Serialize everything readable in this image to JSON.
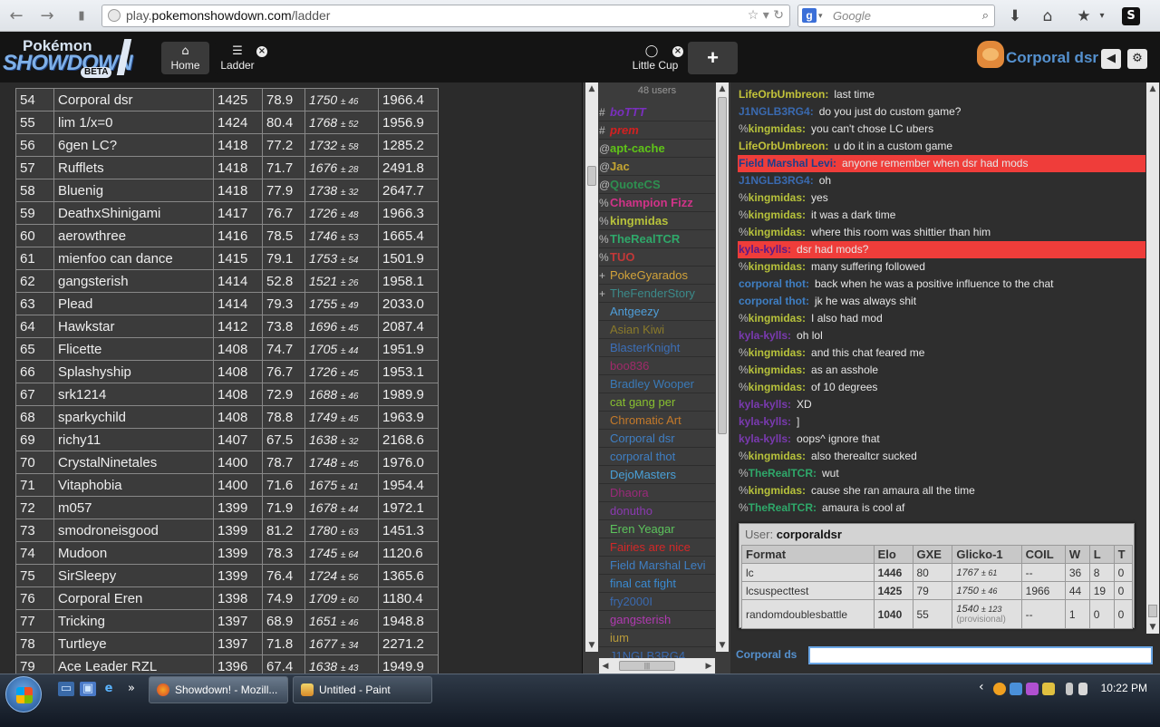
{
  "browser": {
    "url_prefix": "play.",
    "url_domain": "pokemonshowdown.com",
    "url_path": "/ladder",
    "search_placeholder": "Google",
    "search_engine_letter": "g"
  },
  "header": {
    "logo_line1": "Pokémon",
    "logo_line2": "SHOWDOWN",
    "logo_badge": "BETA",
    "tabs": [
      {
        "label": "Home",
        "icon": "home-icon"
      },
      {
        "label": "Ladder",
        "icon": "list-icon"
      },
      {
        "label": "Little Cup",
        "icon": "chat-bubble-icon"
      }
    ],
    "plus_label": "+",
    "username": "Corporal dsr"
  },
  "ladder": {
    "rows": [
      {
        "rank": "54",
        "name": "Corporal dsr",
        "elo": "1425",
        "gxe": "78.9",
        "glicko": "1750",
        "dev": "± 46",
        "coil": "1966.4"
      },
      {
        "rank": "55",
        "name": "lim 1/x=0",
        "elo": "1424",
        "gxe": "80.4",
        "glicko": "1768",
        "dev": "± 52",
        "coil": "1956.9"
      },
      {
        "rank": "56",
        "name": "6gen LC?",
        "elo": "1418",
        "gxe": "77.2",
        "glicko": "1732",
        "dev": "± 58",
        "coil": "1285.2"
      },
      {
        "rank": "57",
        "name": "Rufflets",
        "elo": "1418",
        "gxe": "71.7",
        "glicko": "1676",
        "dev": "± 28",
        "coil": "2491.8"
      },
      {
        "rank": "58",
        "name": "Bluenig",
        "elo": "1418",
        "gxe": "77.9",
        "glicko": "1738",
        "dev": "± 32",
        "coil": "2647.7"
      },
      {
        "rank": "59",
        "name": "DeathxShinigami",
        "elo": "1417",
        "gxe": "76.7",
        "glicko": "1726",
        "dev": "± 48",
        "coil": "1966.3"
      },
      {
        "rank": "60",
        "name": "aerowthree",
        "elo": "1416",
        "gxe": "78.5",
        "glicko": "1746",
        "dev": "± 53",
        "coil": "1665.4"
      },
      {
        "rank": "61",
        "name": "mienfoo can dance",
        "elo": "1415",
        "gxe": "79.1",
        "glicko": "1753",
        "dev": "± 54",
        "coil": "1501.9"
      },
      {
        "rank": "62",
        "name": "gangsterish",
        "elo": "1414",
        "gxe": "52.8",
        "glicko": "1521",
        "dev": "± 26",
        "coil": "1958.1"
      },
      {
        "rank": "63",
        "name": "Plead",
        "elo": "1414",
        "gxe": "79.3",
        "glicko": "1755",
        "dev": "± 49",
        "coil": "2033.0"
      },
      {
        "rank": "64",
        "name": "Hawkstar",
        "elo": "1412",
        "gxe": "73.8",
        "glicko": "1696",
        "dev": "± 45",
        "coil": "2087.4"
      },
      {
        "rank": "65",
        "name": "Flicette",
        "elo": "1408",
        "gxe": "74.7",
        "glicko": "1705",
        "dev": "± 44",
        "coil": "1951.9"
      },
      {
        "rank": "66",
        "name": "Splashyship",
        "elo": "1408",
        "gxe": "76.7",
        "glicko": "1726",
        "dev": "± 45",
        "coil": "1953.1"
      },
      {
        "rank": "67",
        "name": "srk1214",
        "elo": "1408",
        "gxe": "72.9",
        "glicko": "1688",
        "dev": "± 46",
        "coil": "1989.9"
      },
      {
        "rank": "68",
        "name": "sparkychild",
        "elo": "1408",
        "gxe": "78.8",
        "glicko": "1749",
        "dev": "± 45",
        "coil": "1963.9"
      },
      {
        "rank": "69",
        "name": "richy11",
        "elo": "1407",
        "gxe": "67.5",
        "glicko": "1638",
        "dev": "± 32",
        "coil": "2168.6"
      },
      {
        "rank": "70",
        "name": "CrystalNinetales",
        "elo": "1400",
        "gxe": "78.7",
        "glicko": "1748",
        "dev": "± 45",
        "coil": "1976.0"
      },
      {
        "rank": "71",
        "name": "Vitaphobia",
        "elo": "1400",
        "gxe": "71.6",
        "glicko": "1675",
        "dev": "± 41",
        "coil": "1954.4"
      },
      {
        "rank": "72",
        "name": "m057",
        "elo": "1399",
        "gxe": "71.9",
        "glicko": "1678",
        "dev": "± 44",
        "coil": "1972.1"
      },
      {
        "rank": "73",
        "name": "smodroneisgood",
        "elo": "1399",
        "gxe": "81.2",
        "glicko": "1780",
        "dev": "± 63",
        "coil": "1451.3"
      },
      {
        "rank": "74",
        "name": "Mudoon",
        "elo": "1399",
        "gxe": "78.3",
        "glicko": "1745",
        "dev": "± 64",
        "coil": "1120.6"
      },
      {
        "rank": "75",
        "name": "SirSleepy",
        "elo": "1399",
        "gxe": "76.4",
        "glicko": "1724",
        "dev": "± 56",
        "coil": "1365.6"
      },
      {
        "rank": "76",
        "name": "Corporal Eren",
        "elo": "1398",
        "gxe": "74.9",
        "glicko": "1709",
        "dev": "± 60",
        "coil": "1180.4"
      },
      {
        "rank": "77",
        "name": "Tricking",
        "elo": "1397",
        "gxe": "68.9",
        "glicko": "1651",
        "dev": "± 46",
        "coil": "1948.8"
      },
      {
        "rank": "78",
        "name": "Turtleye",
        "elo": "1397",
        "gxe": "71.8",
        "glicko": "1677",
        "dev": "± 34",
        "coil": "2271.2"
      },
      {
        "rank": "79",
        "name": "Ace Leader RZL",
        "elo": "1396",
        "gxe": "67.4",
        "glicko": "1638",
        "dev": "± 43",
        "coil": "1949.9"
      }
    ]
  },
  "userlist": {
    "count_label": "48 users",
    "users": [
      {
        "group": "#",
        "name": "boTTT",
        "color": "#7a2fbf",
        "style": "italic"
      },
      {
        "group": "#",
        "name": "prem",
        "color": "#d32020",
        "style": "italic"
      },
      {
        "group": "@",
        "name": "apt-cache",
        "color": "#5fc418",
        "style": "bold"
      },
      {
        "group": "@",
        "name": "Jac",
        "color": "#c4a532",
        "style": "bold"
      },
      {
        "group": "@",
        "name": "QuoteCS",
        "color": "#2e8f50",
        "style": "bold"
      },
      {
        "group": "%",
        "name": "Champion Fizz",
        "color": "#d03388",
        "style": "bold"
      },
      {
        "group": "%",
        "name": "kingmidas",
        "color": "#b7c23b",
        "style": "bold"
      },
      {
        "group": "%",
        "name": "TheRealTCR",
        "color": "#2fa86a",
        "style": "bold"
      },
      {
        "group": "%",
        "name": "TUO",
        "color": "#c23838",
        "style": "bold"
      },
      {
        "group": "+",
        "name": "PokeGyarados",
        "color": "#d2a33a",
        "style": "normal"
      },
      {
        "group": "+",
        "name": "TheFenderStory",
        "color": "#3b8a8a",
        "style": "normal"
      },
      {
        "group": "",
        "name": "Antgeezy",
        "color": "#4f9ed9",
        "style": "normal"
      },
      {
        "group": "",
        "name": "Asian Kiwi",
        "color": "#8a7a2a",
        "style": "normal"
      },
      {
        "group": "",
        "name": "BlasterKnight",
        "color": "#3c6fb8",
        "style": "normal"
      },
      {
        "group": "",
        "name": "boo836",
        "color": "#a02a6a",
        "style": "normal"
      },
      {
        "group": "",
        "name": "Bradley Wooper",
        "color": "#3a7ab8",
        "style": "normal"
      },
      {
        "group": "",
        "name": "cat gang per",
        "color": "#88c030",
        "style": "normal"
      },
      {
        "group": "",
        "name": "Chromatic Art",
        "color": "#c57a2a",
        "style": "normal"
      },
      {
        "group": "",
        "name": "Corporal dsr",
        "color": "#3f7fc4",
        "style": "normal"
      },
      {
        "group": "",
        "name": "corporal thot",
        "color": "#3f7fc4",
        "style": "normal"
      },
      {
        "group": "",
        "name": "DejoMasters",
        "color": "#4aa0d8",
        "style": "normal"
      },
      {
        "group": "",
        "name": "Dhaora",
        "color": "#9a2a7a",
        "style": "normal"
      },
      {
        "group": "",
        "name": "donutho",
        "color": "#8a3ab0",
        "style": "normal"
      },
      {
        "group": "",
        "name": "Eren Yeagar",
        "color": "#5cc35c",
        "style": "normal"
      },
      {
        "group": "",
        "name": "Fairies are nice",
        "color": "#d32828",
        "style": "normal"
      },
      {
        "group": "",
        "name": "Field Marshal Levi",
        "color": "#3f7fc4",
        "style": "normal"
      },
      {
        "group": "",
        "name": "final cat fight",
        "color": "#3a8ad0",
        "style": "normal"
      },
      {
        "group": "",
        "name": "fry2000I",
        "color": "#3a6ab0",
        "style": "normal"
      },
      {
        "group": "",
        "name": "gangsterish",
        "color": "#b03ab0",
        "style": "normal"
      },
      {
        "group": "",
        "name": "ium",
        "color": "#b89a3a",
        "style": "normal"
      },
      {
        "group": "",
        "name": "J1NGLB3RG4",
        "color": "#3a6ab0",
        "style": "normal"
      }
    ]
  },
  "chat": {
    "messages": [
      {
        "sym": "",
        "user": "LifeOrbUmbreon:",
        "color": "#c3c33a",
        "text": "last time",
        "hl": false
      },
      {
        "sym": "",
        "user": "J1NGLB3RG4:",
        "color": "#3a6ab0",
        "text": "do you just do custom game?",
        "hl": false
      },
      {
        "sym": "%",
        "user": "kingmidas:",
        "color": "#b7c23b",
        "text": "you can't chose LC ubers",
        "hl": false
      },
      {
        "sym": "",
        "user": "LifeOrbUmbreon:",
        "color": "#c3c33a",
        "text": "u do it in a custom game",
        "hl": false
      },
      {
        "sym": "",
        "user": "Field Marshal Levi:",
        "color": "#1c3e8a",
        "text": "anyone remember when dsr had mods",
        "hl": true
      },
      {
        "sym": "",
        "user": "J1NGLB3RG4:",
        "color": "#3a6ab0",
        "text": "oh",
        "hl": false
      },
      {
        "sym": "%",
        "user": "kingmidas:",
        "color": "#b7c23b",
        "text": "yes",
        "hl": false
      },
      {
        "sym": "%",
        "user": "kingmidas:",
        "color": "#b7c23b",
        "text": "it was a dark time",
        "hl": false
      },
      {
        "sym": "%",
        "user": "kingmidas:",
        "color": "#b7c23b",
        "text": "where this room was shittier than him",
        "hl": false
      },
      {
        "sym": "",
        "user": "kyla-kylls:",
        "color": "#5a1a8a",
        "text": "dsr had mods?",
        "hl": true
      },
      {
        "sym": "%",
        "user": "kingmidas:",
        "color": "#b7c23b",
        "text": "many suffering followed",
        "hl": false
      },
      {
        "sym": "",
        "user": "corporal thot:",
        "color": "#3f7fc4",
        "text": "back when he was a positive influence to the chat",
        "hl": false
      },
      {
        "sym": "",
        "user": "corporal thot:",
        "color": "#3f7fc4",
        "text": "jk he was always shit",
        "hl": false
      },
      {
        "sym": "%",
        "user": "kingmidas:",
        "color": "#b7c23b",
        "text": "I also had mod",
        "hl": false
      },
      {
        "sym": "",
        "user": "kyla-kylls:",
        "color": "#7a3ab0",
        "text": "oh lol",
        "hl": false
      },
      {
        "sym": "%",
        "user": "kingmidas:",
        "color": "#b7c23b",
        "text": "and this chat feared me",
        "hl": false
      },
      {
        "sym": "%",
        "user": "kingmidas:",
        "color": "#b7c23b",
        "text": "as an asshole",
        "hl": false
      },
      {
        "sym": "%",
        "user": "kingmidas:",
        "color": "#b7c23b",
        "text": "of 10 degrees",
        "hl": false
      },
      {
        "sym": "",
        "user": "kyla-kylls:",
        "color": "#7a3ab0",
        "text": "XD",
        "hl": false
      },
      {
        "sym": "",
        "user": "kyla-kylls:",
        "color": "#7a3ab0",
        "text": "]",
        "hl": false
      },
      {
        "sym": "",
        "user": "kyla-kylls:",
        "color": "#7a3ab0",
        "text": "oops^ ignore that",
        "hl": false
      },
      {
        "sym": "%",
        "user": "kingmidas:",
        "color": "#b7c23b",
        "text": "also therealtcr sucked",
        "hl": false
      },
      {
        "sym": "%",
        "user": "TheRealTCR:",
        "color": "#2fa86a",
        "text": "wut",
        "hl": false
      },
      {
        "sym": "%",
        "user": "kingmidas:",
        "color": "#b7c23b",
        "text": "cause she ran amaura all the time",
        "hl": false
      },
      {
        "sym": "%",
        "user": "TheRealTCR:",
        "color": "#2fa86a",
        "text": "amaura is cool af",
        "hl": false
      }
    ],
    "input_label": "Corporal ds",
    "input_value": ""
  },
  "popup": {
    "user_label": "User:",
    "user_name": "corporaldsr",
    "headers": [
      "Format",
      "Elo",
      "GXE",
      "Glicko-1",
      "COIL",
      "W",
      "L",
      "T"
    ],
    "rows": [
      {
        "format": "lc",
        "elo": "1446",
        "gxe": "80",
        "glicko": "1767",
        "dev": "± 61",
        "prov": "",
        "coil": "--",
        "w": "36",
        "l": "8",
        "t": "0"
      },
      {
        "format": "lcsuspecttest",
        "elo": "1425",
        "gxe": "79",
        "glicko": "1750",
        "dev": "± 46",
        "prov": "",
        "coil": "1966",
        "w": "44",
        "l": "19",
        "t": "0"
      },
      {
        "format": "randomdoublesbattle",
        "elo": "1040",
        "gxe": "55",
        "glicko": "1540",
        "dev": "± 123",
        "prov": "(provisional)",
        "coil": "--",
        "w": "1",
        "l": "0",
        "t": "0"
      }
    ]
  },
  "taskbar": {
    "tasks": [
      {
        "label": "Showdown! - Mozill...",
        "icon": "firefox-icon"
      },
      {
        "label": "Untitled - Paint",
        "icon": "paint-icon"
      }
    ],
    "quicklaunch_more": "»",
    "clock": "10:22 PM"
  }
}
